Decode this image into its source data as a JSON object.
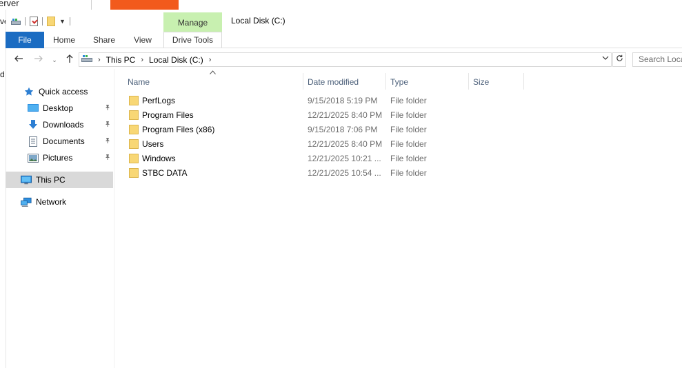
{
  "background": {
    "window_title_fragment": "erver",
    "side_fragment_top": "ve",
    "side_fragment_mid": "d"
  },
  "ribbon": {
    "contextual_group": "Manage",
    "contextual_tab": "Drive Tools",
    "window_title": "Local Disk (C:)",
    "tabs": [
      {
        "label": "File"
      },
      {
        "label": "Home"
      },
      {
        "label": "Share"
      },
      {
        "label": "View"
      }
    ]
  },
  "address": {
    "crumbs": [
      "This PC",
      "Local Disk (C:)"
    ],
    "search_placeholder": "Search Loca"
  },
  "sidebar": {
    "quick_access": "Quick access",
    "items": [
      {
        "label": "Desktop",
        "pinned": true
      },
      {
        "label": "Downloads",
        "pinned": true
      },
      {
        "label": "Documents",
        "pinned": true
      },
      {
        "label": "Pictures",
        "pinned": true
      }
    ],
    "this_pc": "This PC",
    "network": "Network"
  },
  "columns": {
    "name": "Name",
    "date": "Date modified",
    "type": "Type",
    "size": "Size"
  },
  "files": [
    {
      "name": "PerfLogs",
      "date": "9/15/2018 5:19 PM",
      "type": "File folder"
    },
    {
      "name": "Program Files",
      "date": "12/21/2025 8:40 PM",
      "type": "File folder"
    },
    {
      "name": "Program Files (x86)",
      "date": "9/15/2018 7:06 PM",
      "type": "File folder"
    },
    {
      "name": "Users",
      "date": "12/21/2025 8:40 PM",
      "type": "File folder"
    },
    {
      "name": "Windows",
      "date": "12/21/2025 10:21 ...",
      "type": "File folder"
    },
    {
      "name": "STBC DATA",
      "date": "12/21/2025 10:54 ...",
      "type": "File folder"
    }
  ],
  "colors": {
    "file_tab": "#1b6cc2",
    "manage_tab": "#c8f0b0",
    "folder": "#f8d775",
    "selected": "#d9d9d9",
    "orange": "#f25a1c"
  }
}
